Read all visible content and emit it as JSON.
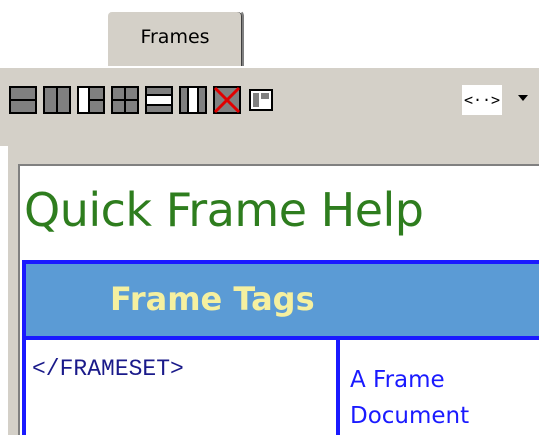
{
  "tab": {
    "label": "Frames"
  },
  "toolbar": {
    "buttons": [
      "frameset-horizontal-split-icon",
      "frameset-vertical-split-icon",
      "frameset-left-top-bottom-icon",
      "frameset-four-way-icon",
      "frameset-top-middle-bottom-icon",
      "frameset-left-middle-right-icon",
      "frameset-delete-icon",
      "frame-properties-icon"
    ],
    "tag_button": "<··>"
  },
  "document": {
    "title": "Quick Frame Help",
    "banner": "Frame Tags",
    "row": {
      "tag": "</FRAMESET>",
      "description": "A Frame Document"
    }
  },
  "colors": {
    "title": "#2e7d1e",
    "banner_bg": "#5b9bd5",
    "banner_text": "#f5f0a0",
    "table_border": "#1a1aff"
  }
}
